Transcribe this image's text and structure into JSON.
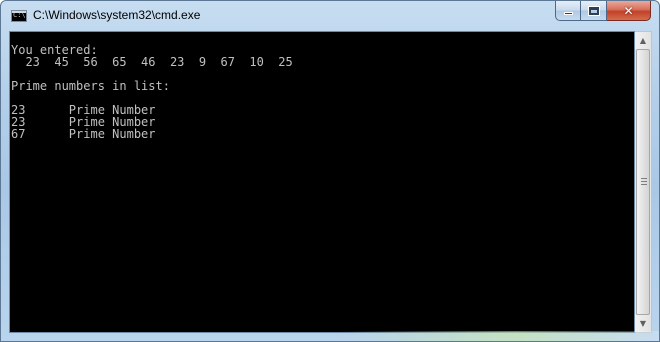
{
  "window": {
    "title": "C:\\Windows\\system32\\cmd.exe",
    "app_icon_label": "C:\\."
  },
  "caption_buttons": {
    "minimize_icon": "minimize-icon",
    "maximize_icon": "maximize-icon",
    "close_glyph": "✕"
  },
  "console": {
    "background": "#000000",
    "foreground": "#c0c0c0",
    "lines": [
      "You entered:",
      "  23  45  56  65  46  23  9  67  10  25",
      "",
      "Prime numbers in list:",
      "",
      "23      Prime Number",
      "23      Prime Number",
      "67      Prime Number"
    ]
  },
  "scrollbar": {
    "up_arrow": "▲",
    "down_arrow": "▼"
  }
}
